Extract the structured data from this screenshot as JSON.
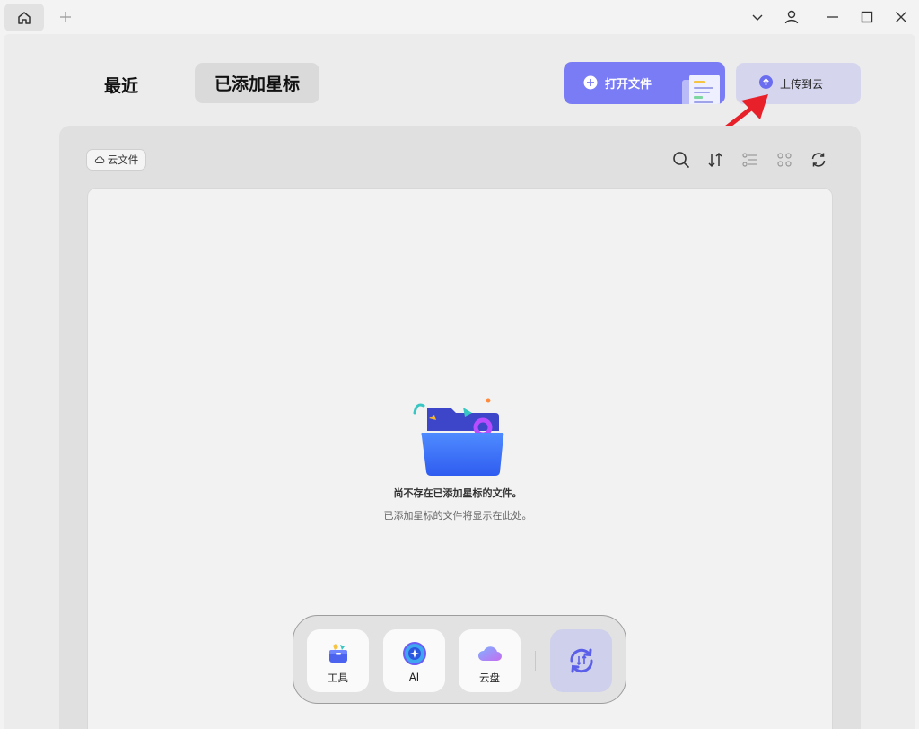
{
  "titlebar": {
    "icons": [
      "home-icon",
      "plus-icon",
      "chevron-down-icon",
      "user-icon",
      "minimize-icon",
      "maximize-icon",
      "close-icon"
    ]
  },
  "nav": {
    "recent": "最近",
    "starred": "已添加星标"
  },
  "actions": {
    "open_file": "打开文件",
    "upload_cloud": "上传到云"
  },
  "toolbar": {
    "cloud_files": "云文件",
    "icons": [
      "search-icon",
      "sort-icon",
      "list-view-icon",
      "grid-view-icon",
      "refresh-icon"
    ]
  },
  "empty_state": {
    "title": "尚不存在已添加星标的文件。",
    "subtitle": "已添加星标的文件将显示在此处。"
  },
  "dock": {
    "tools": "工具",
    "ai": "AI",
    "cloud_drive": "云盘"
  },
  "colors": {
    "accent": "#7a7cf5",
    "upload_bg": "#d5d6ee",
    "annotation_arrow": "#e8202a"
  }
}
